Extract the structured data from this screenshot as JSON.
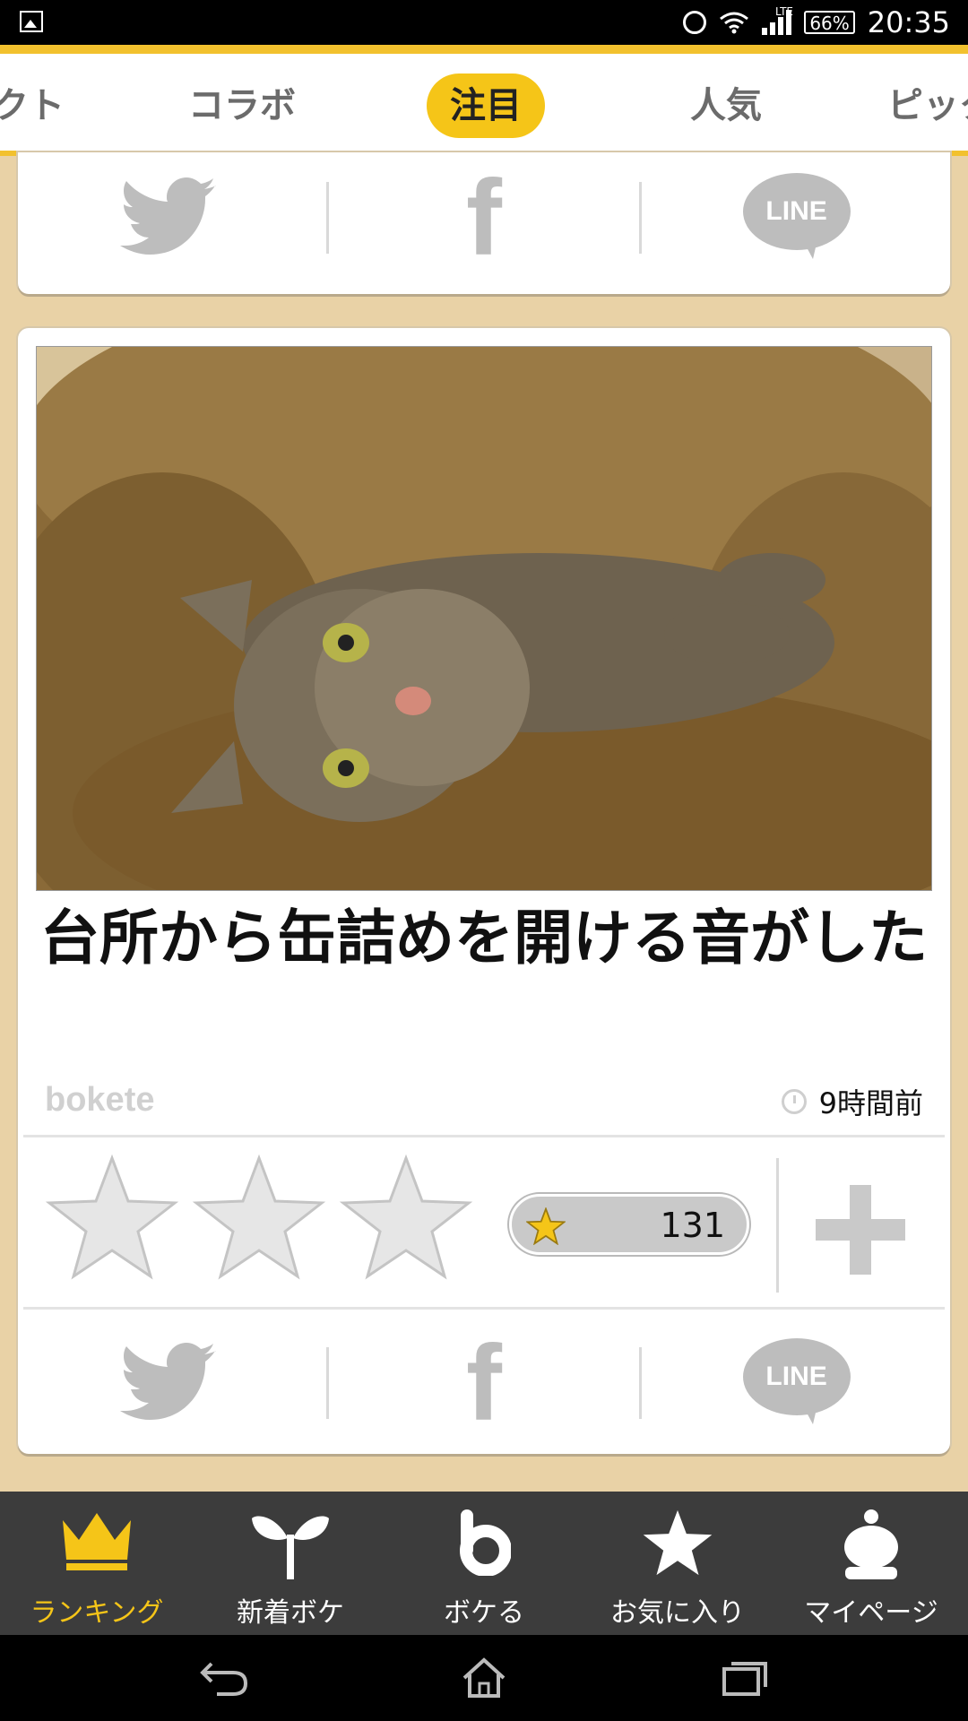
{
  "status_bar": {
    "time": "20:35",
    "battery": "66%",
    "network": "LTE"
  },
  "tabs": [
    "クト",
    "コラボ",
    "注目",
    "人気",
    "ピック"
  ],
  "active_tab": 2,
  "share": {
    "line": "LINE",
    "facebook": "f"
  },
  "post": {
    "caption": "台所から缶詰めを開ける音がした",
    "brand": "bokete",
    "time_ago": "9時間前",
    "rating_count": "131"
  },
  "bottom_nav": [
    {
      "label": "ランキング",
      "icon": "crown-icon"
    },
    {
      "label": "新着ボケ",
      "icon": "sprout-icon"
    },
    {
      "label": "ボケる",
      "icon": "b-logo-icon"
    },
    {
      "label": "お気に入り",
      "icon": "star-icon"
    },
    {
      "label": "マイページ",
      "icon": "user-icon"
    }
  ],
  "colors": {
    "accent": "#f5c518",
    "nav_bg": "#3c3c3c",
    "icon_gray": "#bdbdbd"
  }
}
